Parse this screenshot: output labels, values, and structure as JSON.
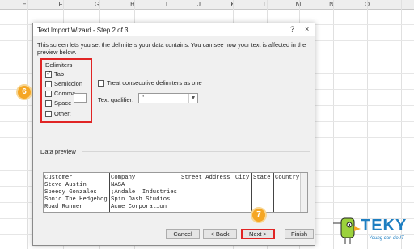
{
  "spreadsheet": {
    "column_letters": [
      "E",
      "F",
      "G",
      "H",
      "I",
      "J",
      "K",
      "L",
      "M",
      "N",
      "O"
    ]
  },
  "dialog": {
    "title": "Text Import Wizard - Step 2 of 3",
    "help_glyph": "?",
    "close_glyph": "×",
    "description": "This screen lets you set the delimiters your data contains.  You can see how your text is affected in the preview below.",
    "delimiters": {
      "heading": "Delimiters",
      "options": [
        {
          "label": "Tab",
          "checked": true
        },
        {
          "label": "Semicolon",
          "checked": false
        },
        {
          "label": "Comma",
          "checked": false
        },
        {
          "label": "Space",
          "checked": false
        },
        {
          "label": "Other:",
          "checked": false
        }
      ],
      "other_value": ""
    },
    "consecutive_label": "Treat consecutive delimiters as one",
    "qualifier": {
      "label": "Text qualifier:",
      "value": "\""
    },
    "preview": {
      "label": "Data preview",
      "columns": [
        {
          "header": "Customer",
          "cells": [
            "Steve Austin",
            "Speedy Gonzales",
            "Sonic The Hedgehog",
            "Road Runner"
          ]
        },
        {
          "header": "Company",
          "cells": [
            "NASA",
            "¡Andale! Industries",
            "Spin Dash Studios",
            "Acme Corporation"
          ]
        },
        {
          "header": "Street Address",
          "cells": [
            "",
            "",
            "",
            ""
          ]
        },
        {
          "header": "City",
          "cells": [
            "",
            "",
            "",
            ""
          ]
        },
        {
          "header": "State",
          "cells": [
            "",
            "",
            "",
            ""
          ]
        },
        {
          "header": "Country",
          "cells": [
            "",
            "",
            "",
            ""
          ]
        },
        {
          "header": "Zi",
          "cells": [
            "",
            "",
            "",
            ""
          ]
        }
      ]
    },
    "buttons": {
      "cancel": "Cancel",
      "back": "< Back",
      "next": "Next >",
      "finish": "Finish"
    }
  },
  "annotations": {
    "badge_6": "6",
    "badge_7": "7"
  },
  "logo": {
    "name": "TEKY",
    "tagline": "Young can do IT"
  },
  "colors": {
    "highlight": "#e02525",
    "badge": "#f5a623",
    "logo": "#1d7ec1"
  }
}
